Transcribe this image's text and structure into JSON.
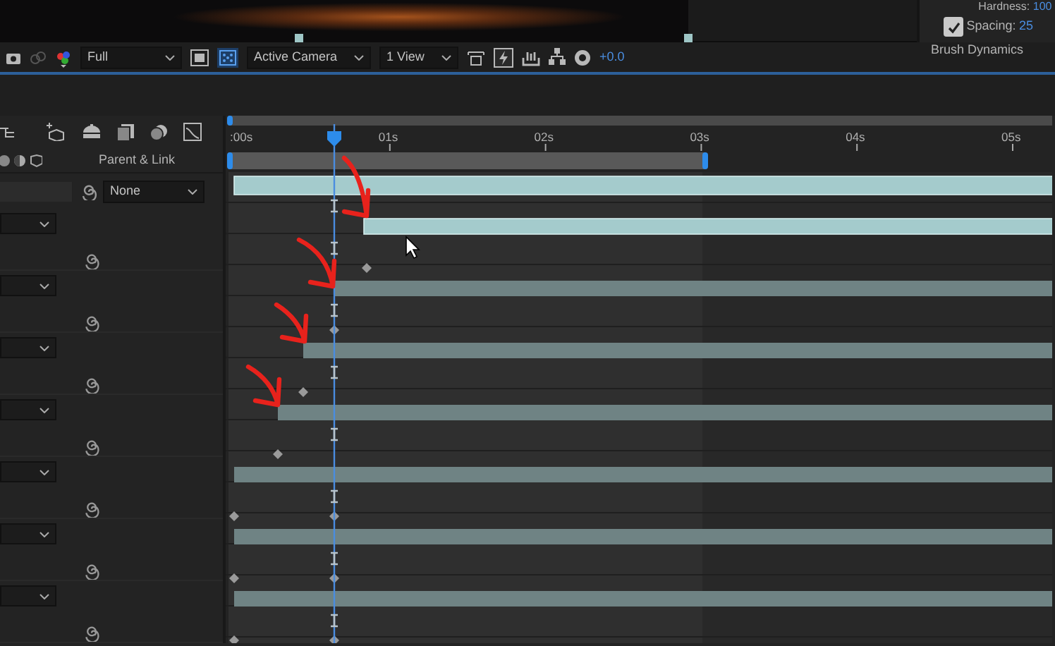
{
  "viewer_toolbar": {
    "resolution": "Full",
    "view": "Active Camera",
    "layout": "1 View",
    "exposure": "+0.0"
  },
  "brush_panel": {
    "hardness_label": "Hardness:",
    "hardness": "100",
    "spacing_checked": true,
    "spacing_label": "Spacing:",
    "spacing": "25",
    "section": "Brush Dynamics"
  },
  "timeline": {
    "parent_header": "Parent & Link",
    "time_ruler": [
      ":00s",
      "01s",
      "02s",
      "03s",
      "04s",
      "05s"
    ],
    "layers": [
      {
        "parent": "None",
        "selected": true
      },
      {
        "selected": true
      },
      {
        "selected": false
      },
      {
        "selected": false
      },
      {
        "selected": false
      },
      {
        "selected": false
      },
      {
        "selected": false
      },
      {
        "selected": false
      }
    ]
  }
}
